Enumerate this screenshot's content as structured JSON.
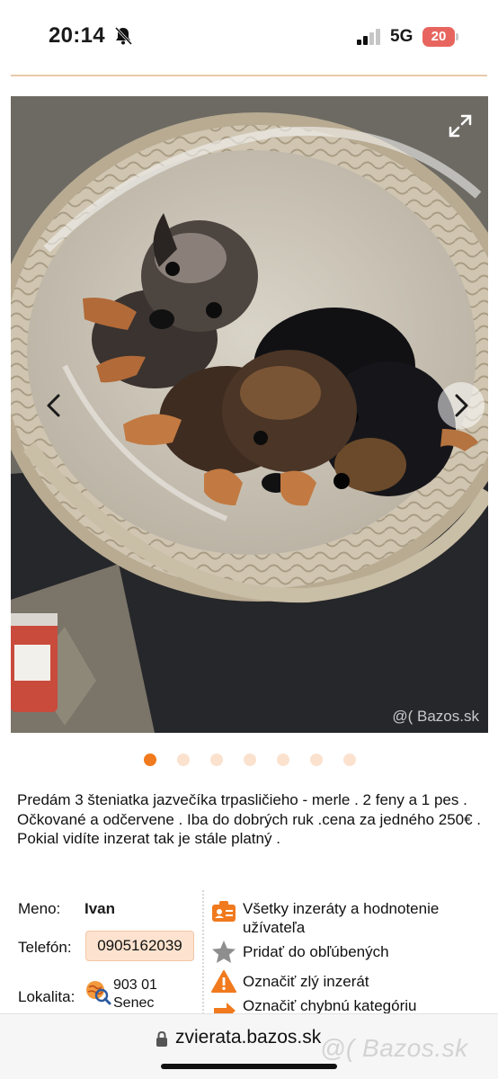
{
  "status_bar": {
    "time": "20:14",
    "network": "5G",
    "battery": "20"
  },
  "gallery": {
    "watermark": "@( Bazos.sk",
    "photo_count": 7,
    "active_index": 0
  },
  "listing": {
    "description": "Predám 3 šteniatka jazvečíka trpasličieho - merle . 2 feny a 1 pes . Očkované a odčervene . Iba do dobrých ruk .cena za jedného 250€ . Pokial vidíte inzerat tak je stále platný ."
  },
  "details": {
    "name_label": "Meno:",
    "name": "Ivan",
    "phone_label": "Telefón:",
    "phone": "0905162039",
    "location_label": "Lokalita:",
    "location_zip": "903 01",
    "location_city": "Senec"
  },
  "actions": {
    "all_ads": "Všetky inzeráty a hodnotenie užívateľa",
    "favorite": "Pridať do obľúbených",
    "report": "Označiť zlý inzerát",
    "wrong_category": "Označiť chybnú kategóriu"
  },
  "browser": {
    "url": "zvierata.bazos.sk",
    "brand": "@( Bazos.sk"
  },
  "colors": {
    "accent": "#f07a1d",
    "phone_bg": "#fde3cf",
    "battery": "#e8655f"
  }
}
